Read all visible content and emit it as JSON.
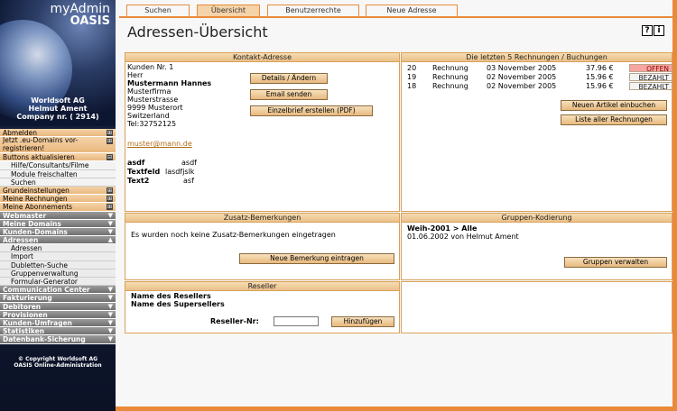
{
  "app": {
    "name_line1": "myAdmin",
    "name_line2": "OASIS",
    "company_line1": "Worldsoft AG",
    "company_line2": "Helmut Ament",
    "company_line3": "Company nr. ( 2914)"
  },
  "tabs": [
    {
      "label": "Suchen",
      "active": false
    },
    {
      "label": "Übersicht",
      "active": true
    },
    {
      "label": "Benutzerrechte",
      "active": false
    },
    {
      "label": "Neue Adresse",
      "active": false
    }
  ],
  "header": {
    "title": "Adressen-Übersicht",
    "help_label": "?",
    "info_label": "i"
  },
  "sidebar": {
    "items": [
      {
        "label": "Abmelden",
        "style": "sect",
        "mark": "⊞"
      },
      {
        "label": "Jetzt .eu-Domains vor-registrieren!",
        "style": "sect",
        "mark": "⊞"
      },
      {
        "label": "Buttons aktualisieren",
        "style": "sect",
        "mark": "⊟"
      },
      {
        "label": "Hilfe/Consultants/Filme",
        "style": "light"
      },
      {
        "label": "Module freischalten",
        "style": "light"
      },
      {
        "label": "Suchen",
        "style": "light"
      },
      {
        "label": "Grundeinstellungen",
        "style": "sect",
        "mark": "⊞"
      },
      {
        "label": "Meine Rechnungen",
        "style": "sect",
        "mark": "⊞"
      },
      {
        "label": "Meine Abonnements",
        "style": "sect",
        "mark": "⊞"
      },
      {
        "label": "Webmaster",
        "style": "dark",
        "mark": "▼"
      },
      {
        "label": "Meine Domains",
        "style": "dark",
        "mark": "▼"
      },
      {
        "label": "Kunden-Domains",
        "style": "dark",
        "mark": "▼"
      },
      {
        "label": "Adressen",
        "style": "dark",
        "mark": "▲"
      },
      {
        "label": "Adressen",
        "style": "light2"
      },
      {
        "label": "Import",
        "style": "light2"
      },
      {
        "label": "Dubletten-Suche",
        "style": "light2"
      },
      {
        "label": "Gruppenverwaltung",
        "style": "light2"
      },
      {
        "label": "Formular-Generator",
        "style": "light2"
      },
      {
        "label": "Communication Center",
        "style": "dark",
        "mark": "▼"
      },
      {
        "label": "Fakturierung",
        "style": "dark",
        "mark": "▼"
      },
      {
        "label": "Debitoren",
        "style": "dark",
        "mark": "▼"
      },
      {
        "label": "Provisionen",
        "style": "dark",
        "mark": "▼"
      },
      {
        "label": "Kunden-Umfragen",
        "style": "dark",
        "mark": "▼"
      },
      {
        "label": "Statistiken",
        "style": "dark",
        "mark": "▼"
      },
      {
        "label": "Datenbank-Sicherung",
        "style": "dark",
        "mark": "▼"
      }
    ],
    "copyright_line1": "© Copyright Worldsoft AG",
    "copyright_line2": "OASIS Online-Administration"
  },
  "contact": {
    "panel_title": "Kontakt-Adresse",
    "customer_no": "Kunden Nr. 1",
    "salutation": "Herr",
    "name": "Mustermann Hannes",
    "company": "Musterfirma",
    "street": "Musterstrasse",
    "city": "9999 Musterort",
    "country": "Switzerland",
    "phone": "Tel:32752125",
    "email": "muster@mann.de",
    "fields": [
      {
        "label": "asdf",
        "value": "asdf"
      },
      {
        "label": "Textfeld",
        "value": "lasdfjslk"
      },
      {
        "label": "Text2",
        "value": "asf"
      }
    ],
    "btn_details": "Details / Ändern",
    "btn_email": "Email senden",
    "btn_letter": "Einzelbrief erstellen (PDF)"
  },
  "invoices": {
    "panel_title": "Die letzten 5 Rechnungen / Buchungen",
    "rows": [
      {
        "no": "20",
        "type": "Rechnung",
        "date": "03 November 2005",
        "amount": "37.96 €",
        "status": "OFFEN"
      },
      {
        "no": "19",
        "type": "Rechnung",
        "date": "02 November 2005",
        "amount": "15.96 €",
        "status": "BEZAHLT"
      },
      {
        "no": "18",
        "type": "Rechnung",
        "date": "02 November 2005",
        "amount": "15.96 €",
        "status": "BEZAHLT"
      }
    ],
    "btn_new_article": "Neuen Artikel einbuchen",
    "btn_all_invoices": "Liste aller Rechnungen"
  },
  "remarks": {
    "panel_title": "Zusatz-Bemerkungen",
    "empty_text": "Es wurden noch keine Zusatz-Bemerkungen eingetragen",
    "btn_new": "Neue Bemerkung eintragen"
  },
  "groups": {
    "panel_title": "Gruppen-Kodierung",
    "line1": "Weih-2001 > Alle",
    "line2": "01.06.2002 von Helmut Ament",
    "btn_manage": "Gruppen verwalten"
  },
  "reseller": {
    "panel_title": "Reseller",
    "reseller_name": "Name des Resellers",
    "superseller_name": "Name des Supersellers",
    "label_no": "Reseller-Nr:",
    "input_value": "",
    "btn_add": "Hinzufügen"
  }
}
